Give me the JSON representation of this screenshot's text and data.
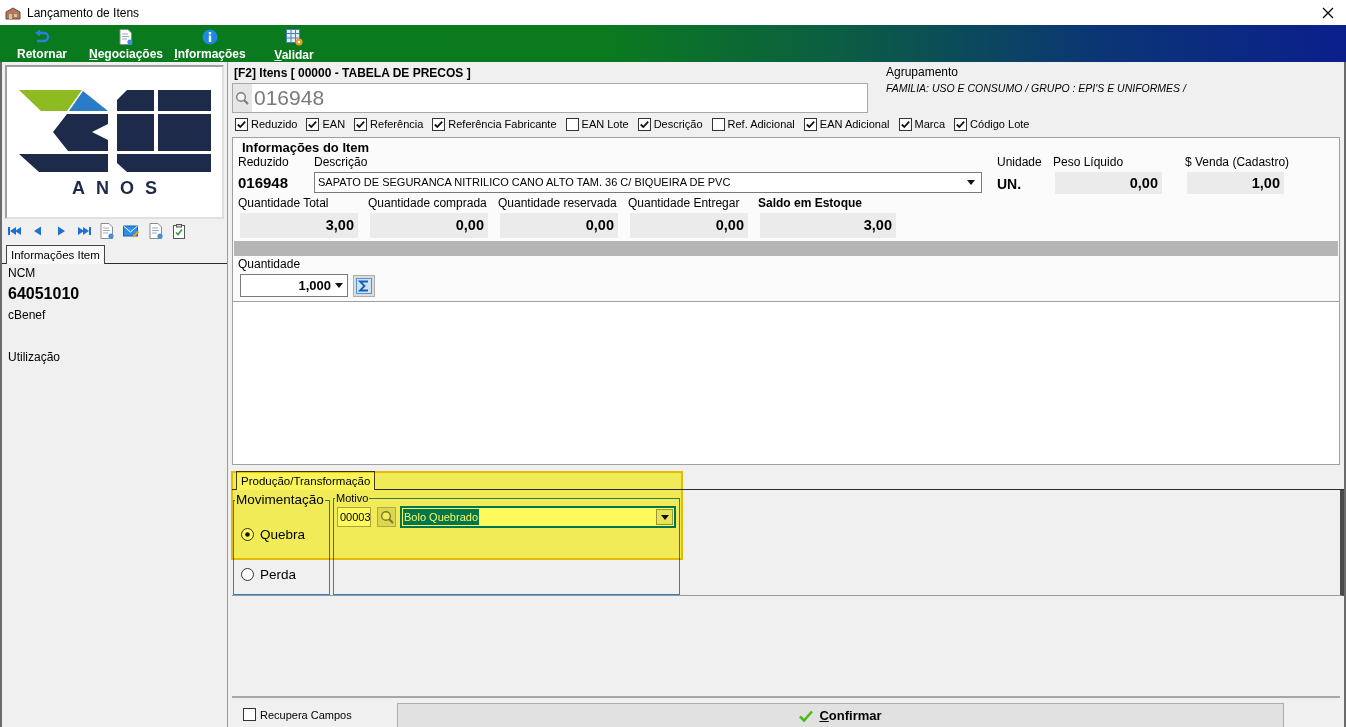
{
  "window": {
    "title": "Lançamento de Itens"
  },
  "toolbar": [
    {
      "label": "Retornar",
      "mnemonic": false
    },
    {
      "label": "Negociações",
      "mnemonic": true
    },
    {
      "label": "Informações",
      "mnemonic": true
    },
    {
      "label": "Validar",
      "mnemonic": true
    }
  ],
  "sidebar": {
    "logo_text": "ANOS",
    "tabs": [
      {
        "label": "Informações Item",
        "selected": true
      }
    ],
    "fields": [
      {
        "label": "NCM",
        "value": "64051010"
      },
      {
        "label": "cBenef"
      },
      {
        "label": "Utilização"
      }
    ]
  },
  "search": {
    "title": "[F2] Itens [ 00000 - TABELA DE PRECOS ]",
    "value": "016948",
    "options": [
      {
        "label": "Reduzido",
        "checked": true
      },
      {
        "label": "EAN",
        "checked": true
      },
      {
        "label": "Referência",
        "checked": true
      },
      {
        "label": "Referência Fabricante",
        "checked": true
      },
      {
        "label": "EAN Lote",
        "checked": false
      },
      {
        "label": "Descrição",
        "checked": true
      },
      {
        "label": "Ref. Adicional",
        "checked": false
      },
      {
        "label": "EAN Adicional",
        "checked": true
      },
      {
        "label": "Marca",
        "checked": true
      },
      {
        "label": "Código Lote",
        "checked": true
      }
    ]
  },
  "grouping": {
    "label": "Agrupamento",
    "value": "FAMILIA: USO E CONSUMO / GRUPO : EPI'S E UNIFORMES /"
  },
  "item_info": {
    "title": "Informações do Item",
    "code": {
      "label": "Reduzido",
      "value": "016948"
    },
    "description": {
      "label": "Descrição",
      "value": "SAPATO DE SEGURANCA NITRILICO CANO ALTO TAM. 36 C/ BIQUEIRA DE PVC"
    },
    "unit": {
      "label": "Unidade",
      "value": "UN."
    },
    "totals": [
      {
        "label": "Peso Líquido",
        "value": "0,00"
      },
      {
        "label": "$ Venda (Cadastro)",
        "value": "1,00"
      }
    ],
    "quantities": [
      {
        "label": "Quantidade Total",
        "value": "3,00",
        "emphasis": false
      },
      {
        "label": "Quantidade comprada",
        "value": "0,00",
        "emphasis": false
      },
      {
        "label": "Quantidade reservada",
        "value": "0,00",
        "emphasis": false
      },
      {
        "label": "Quantidade Entregar",
        "value": "0,00",
        "emphasis": false
      },
      {
        "label": "Saldo em Estoque",
        "value": "3,00",
        "emphasis": true
      }
    ],
    "quantity": {
      "label": "Quantidade",
      "value": "1,000"
    }
  },
  "production": {
    "highlighted": true,
    "tabs": [
      {
        "label": "Produção/Transformação",
        "selected": true
      }
    ],
    "movement": {
      "title": "Movimentação",
      "options": [
        {
          "label": "Quebra",
          "selected": true
        },
        {
          "label": "Perda",
          "selected": false
        }
      ]
    },
    "reason": {
      "title": "Motivo",
      "code": "00003",
      "value": "Bolo Quebrado"
    }
  },
  "footer": {
    "recover_fields": {
      "label": "Recupera Campos",
      "checked": false
    },
    "confirm": {
      "label": "Confirmar",
      "mnemonic": true
    }
  }
}
